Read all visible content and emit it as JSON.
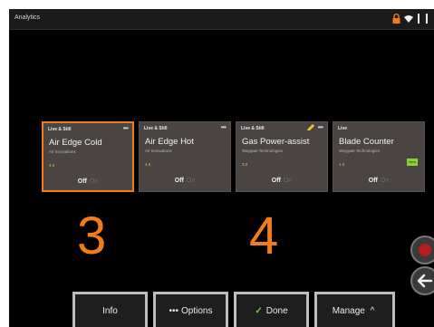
{
  "app": {
    "title": "Analytics"
  },
  "cards": [
    {
      "mode": "Live & Still",
      "name": "Air Edge Cold",
      "vendor": "Air Innovations",
      "version": "4.6",
      "off_label": "Off",
      "on_label": "On",
      "more": "•••",
      "selected": true
    },
    {
      "mode": "Live & Still",
      "name": "Air Edge Hot",
      "vendor": "Air Innovations",
      "version": "4.6",
      "off_label": "Off",
      "on_label": "On",
      "more": "•••"
    },
    {
      "mode": "Live & Still",
      "name": "Gas Power-assist",
      "vendor": "Waygate Technologies",
      "version": "3.0",
      "off_label": "Off",
      "on_label": "On",
      "more": "•••"
    },
    {
      "mode": "Live",
      "name": "Blade Counter",
      "vendor": "Waygate Technologies",
      "version": "1.0",
      "off_label": "Off",
      "on_label": "On",
      "badge": "New"
    }
  ],
  "annotations": [
    "3",
    "4"
  ],
  "buttons": {
    "info": "Info",
    "options": "Options",
    "options_glyph": "•••",
    "done": "Done",
    "done_glyph": "✓",
    "manage": "Manage",
    "manage_glyph": "^"
  },
  "colors": {
    "accent": "#f07d1a",
    "record": "#b81c1c",
    "new_badge": "#8ad233"
  }
}
